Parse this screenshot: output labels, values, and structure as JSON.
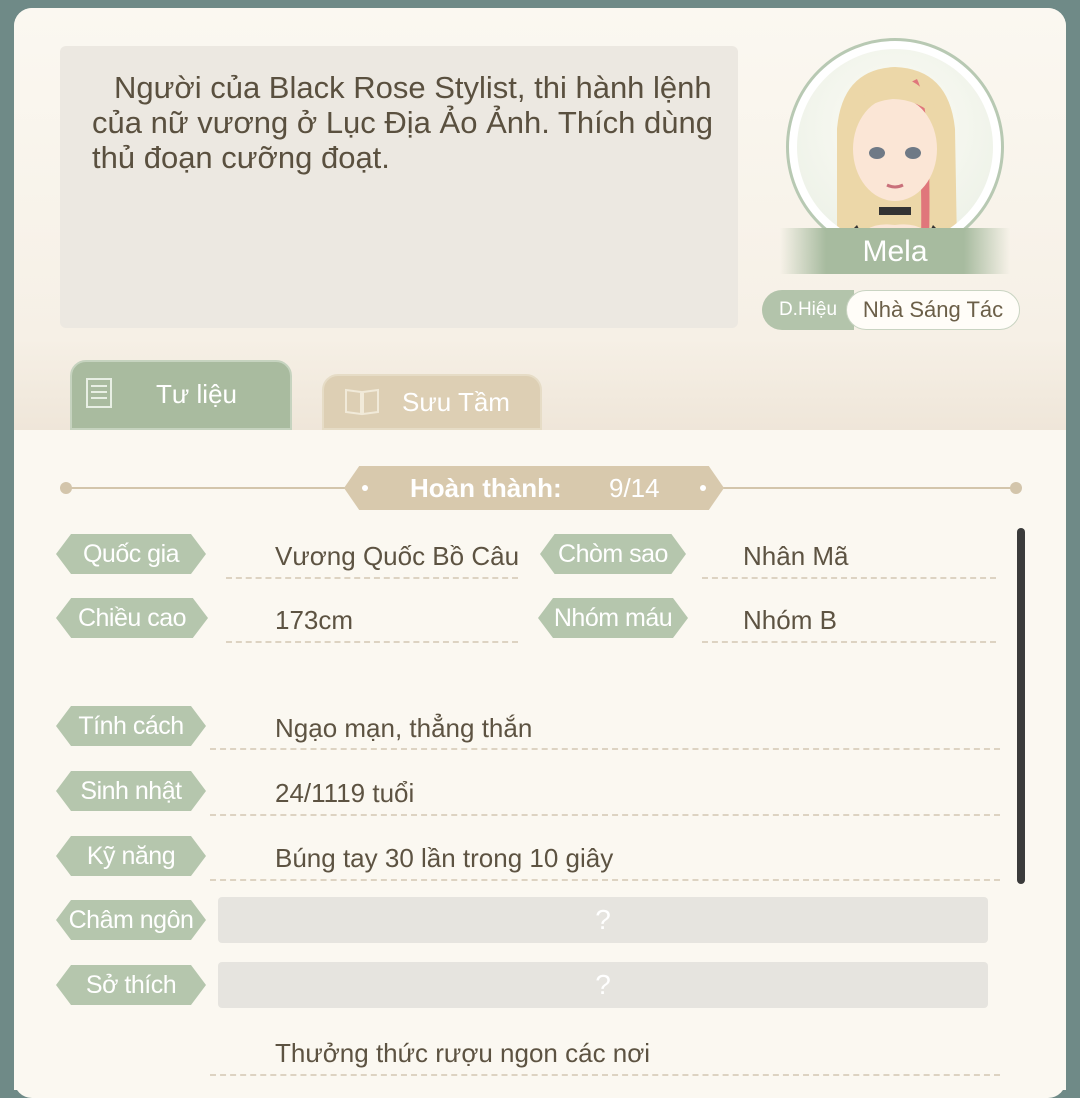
{
  "profile": {
    "description": "Người của Black Rose Stylist, thi hành lệnh của nữ vương ở Lục Địa Ảo Ảnh. Thích dùng thủ đoạn cưỡng đoạt.",
    "name": "Mela",
    "title_label": "D.Hiệu",
    "title_value": "Nhà Sáng Tác"
  },
  "tabs": [
    {
      "label": "Tư liệu",
      "active": true
    },
    {
      "label": "Sưu Tầm",
      "active": false
    }
  ],
  "progress": {
    "label": "Hoàn thành:",
    "value": "9/14"
  },
  "stats": {
    "country": {
      "label": "Quốc gia",
      "value": "Vương Quốc Bồ Câu"
    },
    "constellation": {
      "label": "Chòm sao",
      "value": "Nhân Mã"
    },
    "height": {
      "label": "Chiều cao",
      "value": "173cm"
    },
    "blood_type": {
      "label": "Nhóm máu",
      "value": "Nhóm B"
    },
    "personality": {
      "label": "Tính cách",
      "value": "Ngạo mạn, thẳng thắn"
    },
    "birthday": {
      "label": "Sinh nhật",
      "value": "24/1119 tuổi"
    },
    "skill": {
      "label": "Kỹ năng",
      "value": "Búng tay 30 lần trong 10 giây"
    },
    "motto": {
      "label": "Châm ngôn",
      "value": "?"
    },
    "hobby": {
      "label": "Sở thích",
      "value": "?"
    },
    "extra": {
      "value": "Thưởng thức rượu ngon các nơi"
    }
  },
  "colors": {
    "accent_green": "#b5c6ad",
    "accent_tan": "#d8c9ad",
    "text": "#5d5342"
  }
}
